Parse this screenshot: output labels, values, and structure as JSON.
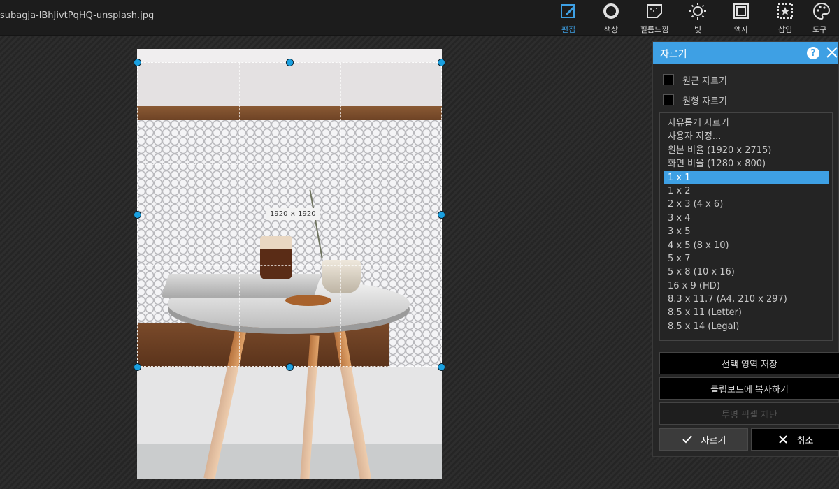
{
  "file": {
    "name": "subagja-lBhJivtPqHQ-unsplash.jpg"
  },
  "toolbar": {
    "tools": [
      {
        "id": "edit",
        "label": "편집",
        "icon": "edit-icon",
        "active": true
      },
      {
        "id": "color",
        "label": "색상",
        "icon": "color-circle-icon"
      },
      {
        "id": "film",
        "label": "필름느낌",
        "icon": "film-icon"
      },
      {
        "id": "light",
        "label": "빛",
        "icon": "sun-icon"
      },
      {
        "id": "frame",
        "label": "액자",
        "icon": "frame-icon"
      },
      {
        "id": "insert",
        "label": "삽입",
        "icon": "star-insert-icon"
      },
      {
        "id": "tools",
        "label": "도구",
        "icon": "palette-icon"
      }
    ],
    "accent_color": "#3ea0e4"
  },
  "canvas": {
    "crop_size_label": "1920 × 1920"
  },
  "crop_panel": {
    "title": "자르기",
    "help_label": "?",
    "perspective_crop_label": "원근 자르기",
    "circle_crop_label": "원형 자르기",
    "ratio_options": [
      "자유롭게 자르기",
      "사용자 지정...",
      "원본 비율 (1920 x 2715)",
      "화면 비율 (1280 x 800)",
      "1 x 1",
      "1 x 2",
      "2 x 3 (4 x 6)",
      "3 x 4",
      "3 x 5",
      "4 x 5 (8 x 10)",
      "5 x 7",
      "5 x 8 (10 x 16)",
      "16 x 9 (HD)",
      "8.3 x 11.7 (A4, 210 x 297)",
      "8.5 x 11 (Letter)",
      "8.5 x 14 (Legal)"
    ],
    "selected_ratio": "1 x 1",
    "save_selection_label": "선택 영역 저장",
    "copy_clipboard_label": "클립보드에 복사하기",
    "trim_transparent_label": "투명 픽셀 재단",
    "apply_label": "자르기",
    "cancel_label": "취소"
  }
}
